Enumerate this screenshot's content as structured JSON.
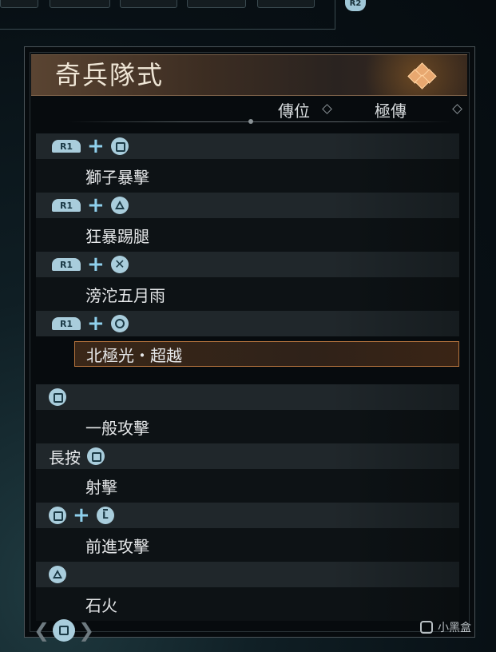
{
  "top": {
    "r2_label": "R2"
  },
  "panel": {
    "title": "奇兵隊式",
    "col_headers": [
      "傳位",
      "極傳"
    ]
  },
  "rows": [
    {
      "combo": [
        "R1",
        "+",
        "square"
      ],
      "move": "獅子暴擊"
    },
    {
      "combo": [
        "R1",
        "+",
        "triangle"
      ],
      "move": "狂暴踢腿"
    },
    {
      "combo": [
        "R1",
        "+",
        "cross"
      ],
      "move": "滂沱五月雨"
    },
    {
      "combo": [
        "R1",
        "+",
        "circle"
      ],
      "move": "北極光・超越",
      "selected": true
    },
    {
      "combo": [
        "square"
      ],
      "move": "一般攻擊"
    },
    {
      "combo": [
        "長按",
        "square"
      ],
      "move": "射擊"
    },
    {
      "combo": [
        "square",
        "+",
        "L-stick"
      ],
      "move": "前進攻擊"
    },
    {
      "combo": [
        "triangle"
      ],
      "move": "石火"
    }
  ],
  "labels": {
    "r1": "R1",
    "plus": "+",
    "hold": "長按",
    "cross_glyph": "✕",
    "lstick_glyph": "L"
  },
  "bottom": {
    "prev": "❮",
    "next": "❯"
  },
  "watermark": {
    "text": "小黑盒"
  }
}
